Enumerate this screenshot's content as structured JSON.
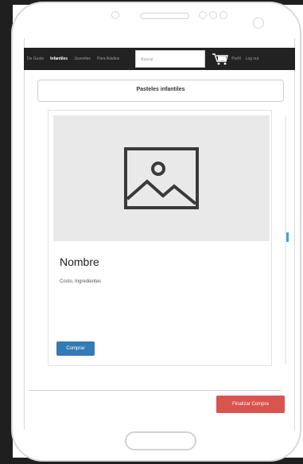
{
  "navbar": {
    "items": [
      {
        "label": "De Gusto",
        "active": false
      },
      {
        "label": "Infantiles",
        "active": true
      },
      {
        "label": "Juveniles",
        "active": false
      },
      {
        "label": "Para Adultos",
        "active": false
      }
    ],
    "search_placeholder": "Buscar",
    "right_items": [
      {
        "label": "Perfil"
      },
      {
        "label": "Log out"
      }
    ],
    "cart_icon": "cart-icon"
  },
  "page": {
    "title": "Pasteles infantiles"
  },
  "card": {
    "image_icon": "image-placeholder-icon",
    "name": "Nombre",
    "description": "Costo, Ingredientes",
    "buy_label": "Comprar"
  },
  "footer": {
    "finish_label": "Finalizar Compra"
  },
  "colors": {
    "navbar_bg": "#222222",
    "primary": "#337ab7",
    "danger": "#d9534f",
    "image_bg": "#e9e9e9"
  }
}
